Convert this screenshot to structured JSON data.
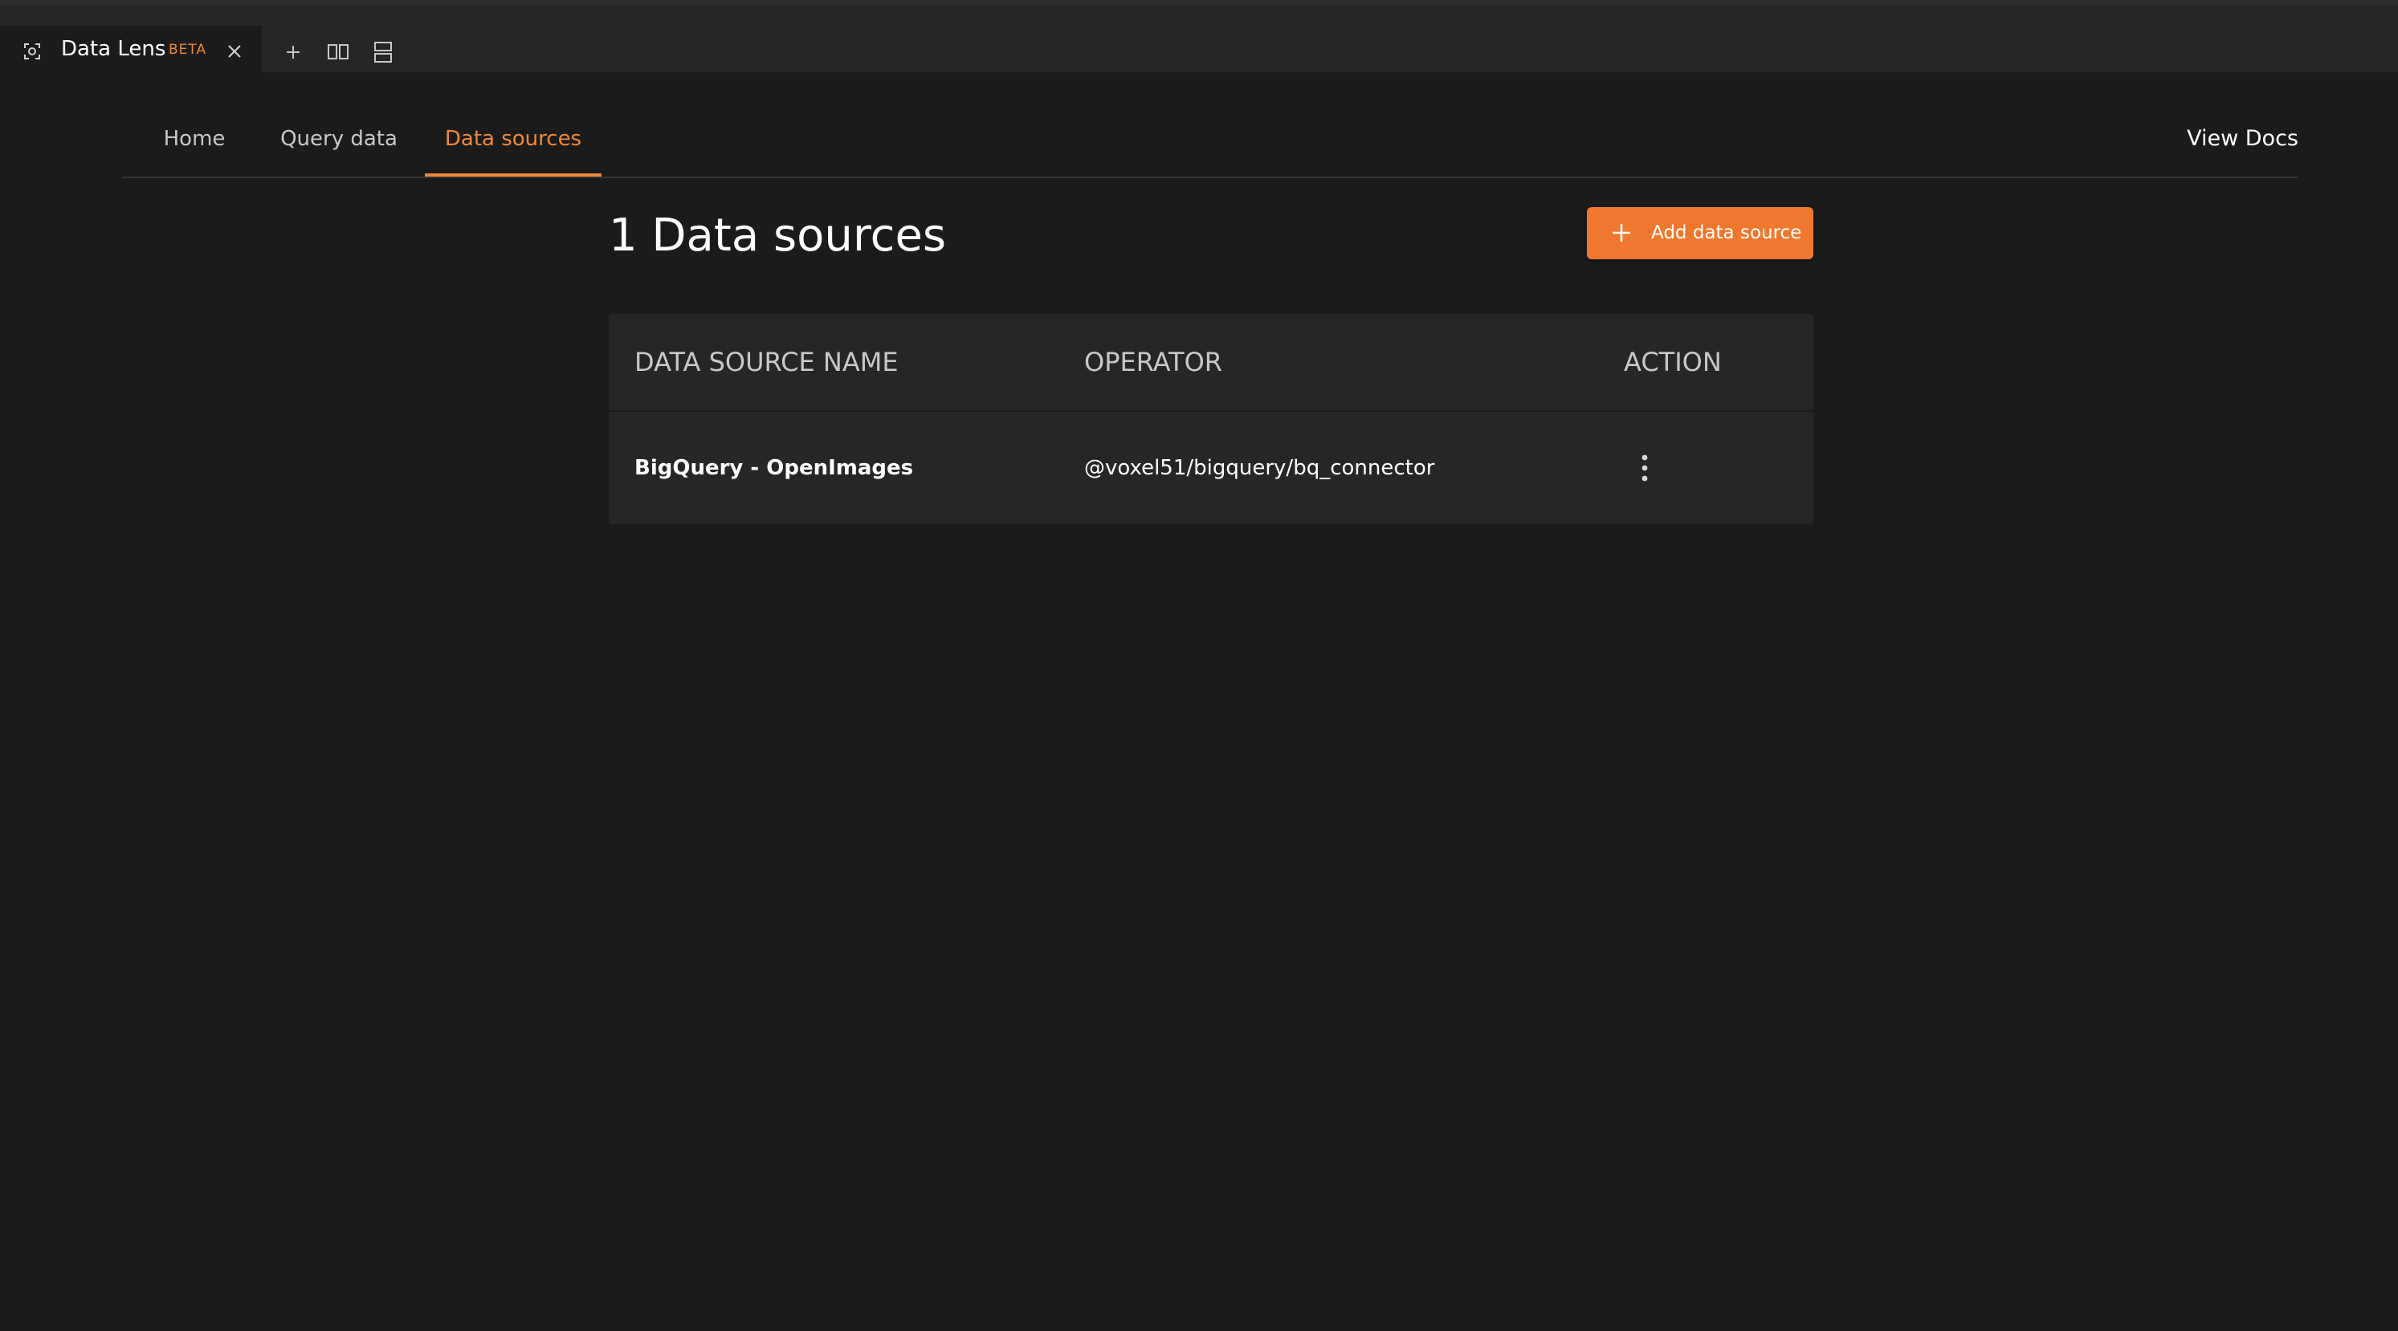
{
  "panel_tab": {
    "title": "Data Lens",
    "badge": "BETA"
  },
  "nav": {
    "tabs": [
      {
        "label": "Home"
      },
      {
        "label": "Query data"
      },
      {
        "label": "Data sources"
      }
    ],
    "active_tab": "Data sources",
    "view_docs": "View Docs"
  },
  "page": {
    "title": "1 Data sources",
    "add_button_label": "Add data source"
  },
  "table": {
    "columns": [
      "DATA SOURCE NAME",
      "OPERATOR",
      "ACTION"
    ],
    "rows": [
      {
        "name": "BigQuery - OpenImages",
        "operator": "@voxel51/bigquery/bq_connector"
      }
    ]
  },
  "colors": {
    "accent": "#f0782e",
    "background": "#1b1b1b",
    "panel": "#262626"
  }
}
